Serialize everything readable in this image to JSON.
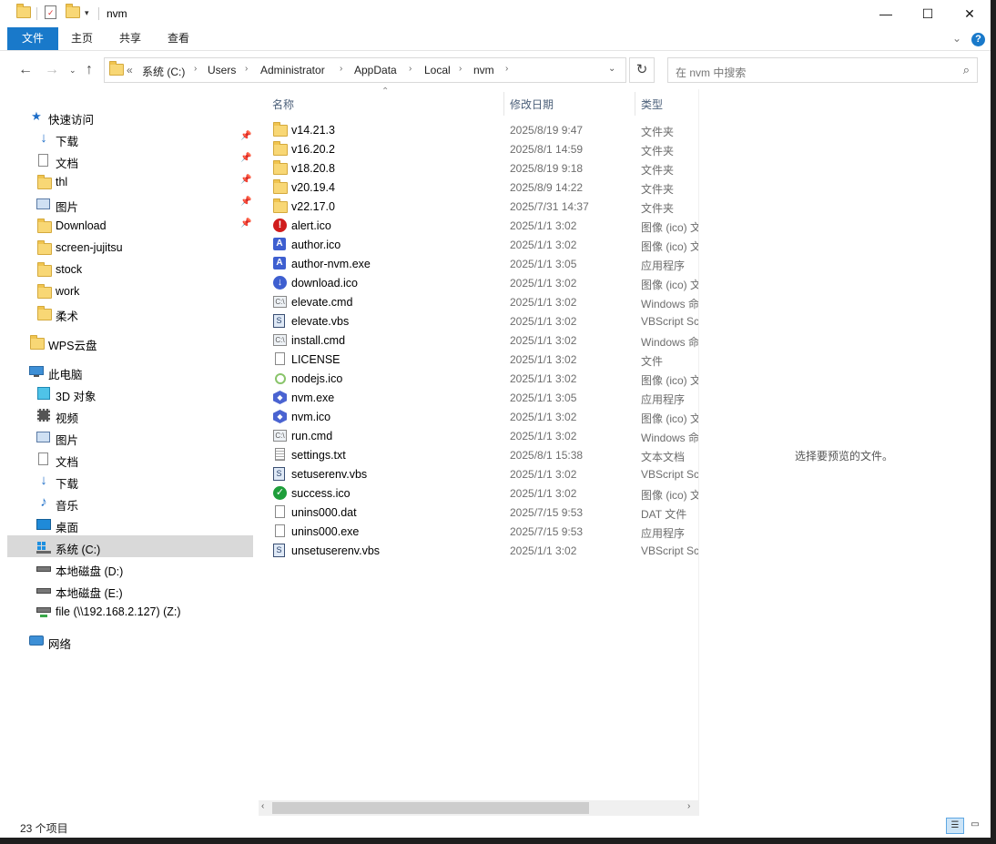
{
  "window": {
    "title": "nvm",
    "buttons": {
      "minimize": "—",
      "maximize": "☐",
      "close": "✕"
    }
  },
  "ribbon": {
    "tabs": [
      "文件",
      "主页",
      "共享",
      "查看"
    ],
    "expand_icon": "chevron-down",
    "help_icon": "?"
  },
  "nav": {
    "breadcrumb_prefix": "«",
    "path": [
      "系统 (C:)",
      "Users",
      "Administrator",
      "AppData",
      "Local",
      "nvm"
    ],
    "search_placeholder": "在 nvm 中搜索"
  },
  "sidebar": {
    "quick_access": {
      "label": "快速访问",
      "items": [
        {
          "label": "下载",
          "icon": "download-arrow",
          "pinned": true
        },
        {
          "label": "文档",
          "icon": "document",
          "pinned": true
        },
        {
          "label": "thl",
          "icon": "folder",
          "pinned": true
        },
        {
          "label": "图片",
          "icon": "pictures",
          "pinned": true
        },
        {
          "label": "Download",
          "icon": "folder",
          "pinned": true
        },
        {
          "label": "screen-jujitsu",
          "icon": "folder",
          "pinned": false
        },
        {
          "label": "stock",
          "icon": "folder",
          "pinned": false
        },
        {
          "label": "work",
          "icon": "folder",
          "pinned": false
        },
        {
          "label": "柔术",
          "icon": "folder",
          "pinned": false
        }
      ]
    },
    "wps": {
      "label": "WPS云盘"
    },
    "this_pc": {
      "label": "此电脑",
      "items": [
        {
          "label": "3D 对象",
          "icon": "3d-cube"
        },
        {
          "label": "视频",
          "icon": "video"
        },
        {
          "label": "图片",
          "icon": "pictures"
        },
        {
          "label": "文档",
          "icon": "document"
        },
        {
          "label": "下载",
          "icon": "download-arrow"
        },
        {
          "label": "音乐",
          "icon": "music-note"
        },
        {
          "label": "桌面",
          "icon": "desktop"
        },
        {
          "label": "系统 (C:)",
          "icon": "windows-drive",
          "selected": true
        },
        {
          "label": "本地磁盘 (D:)",
          "icon": "drive"
        },
        {
          "label": "本地磁盘 (E:)",
          "icon": "drive"
        },
        {
          "label": "file (\\\\192.168.2.127) (Z:)",
          "icon": "network-drive"
        }
      ]
    },
    "network": {
      "label": "网络"
    }
  },
  "columns": {
    "name": "名称",
    "date": "修改日期",
    "type": "类型"
  },
  "files": [
    {
      "name": "v14.21.3",
      "date": "2025/8/19 9:47",
      "type": "文件夹",
      "icon": "folder"
    },
    {
      "name": "v16.20.2",
      "date": "2025/8/1 14:59",
      "type": "文件夹",
      "icon": "folder"
    },
    {
      "name": "v18.20.8",
      "date": "2025/8/19 9:18",
      "type": "文件夹",
      "icon": "folder"
    },
    {
      "name": "v20.19.4",
      "date": "2025/8/9 14:22",
      "type": "文件夹",
      "icon": "folder"
    },
    {
      "name": "v22.17.0",
      "date": "2025/7/31 14:37",
      "type": "文件夹",
      "icon": "folder"
    },
    {
      "name": "alert.ico",
      "date": "2025/1/1 3:02",
      "type": "图像 (ico) 文",
      "icon": "alert"
    },
    {
      "name": "author.ico",
      "date": "2025/1/1 3:02",
      "type": "图像 (ico) 文",
      "icon": "author"
    },
    {
      "name": "author-nvm.exe",
      "date": "2025/1/1 3:05",
      "type": "应用程序",
      "icon": "author"
    },
    {
      "name": "download.ico",
      "date": "2025/1/1 3:02",
      "type": "图像 (ico) 文",
      "icon": "download"
    },
    {
      "name": "elevate.cmd",
      "date": "2025/1/1 3:02",
      "type": "Windows 命",
      "icon": "cmd"
    },
    {
      "name": "elevate.vbs",
      "date": "2025/1/1 3:02",
      "type": "VBScript Sc",
      "icon": "vbs"
    },
    {
      "name": "install.cmd",
      "date": "2025/1/1 3:02",
      "type": "Windows 命",
      "icon": "cmd"
    },
    {
      "name": "LICENSE",
      "date": "2025/1/1 3:02",
      "type": "文件",
      "icon": "doc"
    },
    {
      "name": "nodejs.ico",
      "date": "2025/1/1 3:02",
      "type": "图像 (ico) 文",
      "icon": "node"
    },
    {
      "name": "nvm.exe",
      "date": "2025/1/1 3:05",
      "type": "应用程序",
      "icon": "nvm"
    },
    {
      "name": "nvm.ico",
      "date": "2025/1/1 3:02",
      "type": "图像 (ico) 文",
      "icon": "nvm"
    },
    {
      "name": "run.cmd",
      "date": "2025/1/1 3:02",
      "type": "Windows 命",
      "icon": "cmd"
    },
    {
      "name": "settings.txt",
      "date": "2025/8/1 15:38",
      "type": "文本文档",
      "icon": "txt"
    },
    {
      "name": "setuserenv.vbs",
      "date": "2025/1/1 3:02",
      "type": "VBScript Sc",
      "icon": "vbs"
    },
    {
      "name": "success.ico",
      "date": "2025/1/1 3:02",
      "type": "图像 (ico) 文",
      "icon": "success"
    },
    {
      "name": "unins000.dat",
      "date": "2025/7/15 9:53",
      "type": "DAT 文件",
      "icon": "doc"
    },
    {
      "name": "unins000.exe",
      "date": "2025/7/15 9:53",
      "type": "应用程序",
      "icon": "doc"
    },
    {
      "name": "unsetuserenv.vbs",
      "date": "2025/1/1 3:02",
      "type": "VBScript Sc",
      "icon": "vbs"
    }
  ],
  "preview": {
    "message": "选择要预览的文件。"
  },
  "status": {
    "item_count": "23 个项目"
  }
}
